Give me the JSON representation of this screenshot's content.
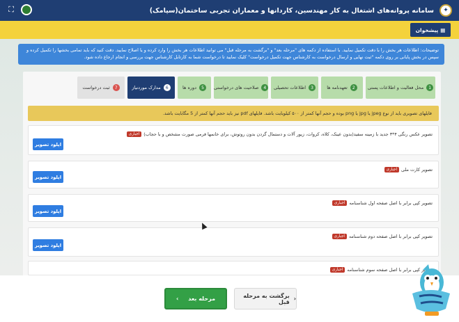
{
  "header": {
    "title": "سامانه پروانه‌های اشتغال به کار مهندسین، کاردانها و معماران تجربی ساختمان(سپامک)",
    "logo_icon": "government-emblem-icon",
    "fullscreen_icon": "expand-icon"
  },
  "dashboard_button": {
    "label": "پیشخوان",
    "icon": "dashboard-icon"
  },
  "info_text": "توضیحات: اطلاعات هر بخش را با دقت تکمیل نمایید. با استفاده از دکمه های \"مرحله بعد\" و \"برگشت به مرحله قبل\" می توانید اطلاعات هر بخش را وارد کرده و یا اصلاح نمایید. دقت کنید که باید تمامی بخشها را تکمیل کرده و سپس در بخش پایانی بر روی دکمه \"ثبت نهایی و ارسال درخواست به کارشناس جهت تکمیل درخواست\" کلیک نمایید تا درخواست شما به کارتابل کارشناس جهت بررسی و انجام ارجاع داده شود.",
  "tabs": [
    {
      "num": "1",
      "label": "محل فعالیت و اطلاعات پستی"
    },
    {
      "num": "2",
      "label": "تعهدنامه ها"
    },
    {
      "num": "3",
      "label": "اطلاعات تحصیلی"
    },
    {
      "num": "4",
      "label": "صلاحیت های درخواستی"
    },
    {
      "num": "5",
      "label": "دوره ها"
    },
    {
      "num": "6",
      "label": "مدارک موردنیاز"
    },
    {
      "num": "7",
      "label": "ثبت درخواست"
    }
  ],
  "warning_text": "فایلهای تصویری باید از نوع jpeg یا jpg یا png بوده و حجم آنها کمتر از ۵۰۰ کیلوبایت باشد. فایلهای pdf نیز باید حجم آنها کمتر از 5 مگابایت باشد.",
  "required_label": "اجباری",
  "upload_label": "اپلود تصویر",
  "documents": [
    {
      "label": "تصویر عکس رنگی ۴*۳ جدید با زمینه سفید(بدون عینک، کلاه، کروات، زیور آلات و دستمال گردن بدون روتوش، برای خانمها فرمی صورت مشخص و با حجاب)"
    },
    {
      "label": "تصویر کارت ملی"
    },
    {
      "label": "تصویر کپی برابر با اصل صفحه اول شناسنامه"
    },
    {
      "label": "تصویر کپی برابر با اصل صفحه دوم شناسنامه"
    },
    {
      "label": "تصویر کپی برابر با اصل صفحه سوم شناسنامه"
    }
  ],
  "buttons": {
    "next": "مرحله بعد",
    "prev": "برگشت به مرحله قبل"
  },
  "colors": {
    "primary": "#1f3e73",
    "accent_yellow": "#f4d23c",
    "success": "#33a046",
    "upload": "#2f7de1",
    "required": "#c0392b"
  }
}
